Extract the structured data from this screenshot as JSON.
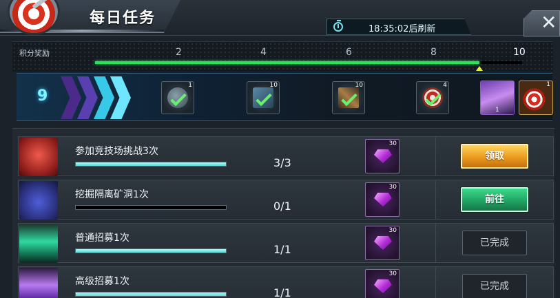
{
  "header": {
    "title": "每日任务",
    "refresh_text": "18:35:02后刷新",
    "close_label": "✕"
  },
  "points": {
    "label": "积分奖励",
    "ticks": [
      "2",
      "4",
      "6",
      "8",
      "10"
    ],
    "current": 9,
    "max": 10,
    "current_display": "9"
  },
  "milestone_rewards": [
    {
      "name": "compass",
      "count": "1",
      "claimed": true
    },
    {
      "name": "map",
      "count": "10",
      "claimed": true
    },
    {
      "name": "arrows",
      "count": "10",
      "claimed": true
    },
    {
      "name": "target-medal",
      "count": "4",
      "claimed": true
    },
    {
      "name": "hero-shard",
      "count": "1",
      "claimed": false
    },
    {
      "name": "target-chest",
      "count": "1",
      "claimed": false
    }
  ],
  "tasks": [
    {
      "name": "参加竞技场挑战3次",
      "progress": "3/3",
      "done": 3,
      "total": 3,
      "reward_count": "30",
      "action": "领取",
      "state": "claim"
    },
    {
      "name": "挖掘隔离矿洞1次",
      "progress": "0/1",
      "done": 0,
      "total": 1,
      "reward_count": "30",
      "action": "前往",
      "state": "go"
    },
    {
      "name": "普通招募1次",
      "progress": "1/1",
      "done": 1,
      "total": 1,
      "reward_count": "30",
      "action": "已完成",
      "state": "completed"
    },
    {
      "name": "高级招募1次",
      "progress": "1/1",
      "done": 1,
      "total": 1,
      "reward_count": "30",
      "action": "已完成",
      "state": "completed"
    }
  ],
  "colors": {
    "accent_cyan": "#7ff3ff",
    "progress_green": "#2fe05a",
    "claim_gold": "#e99b1f",
    "go_green": "#1fa061",
    "gem_purple": "#b22bd6"
  }
}
